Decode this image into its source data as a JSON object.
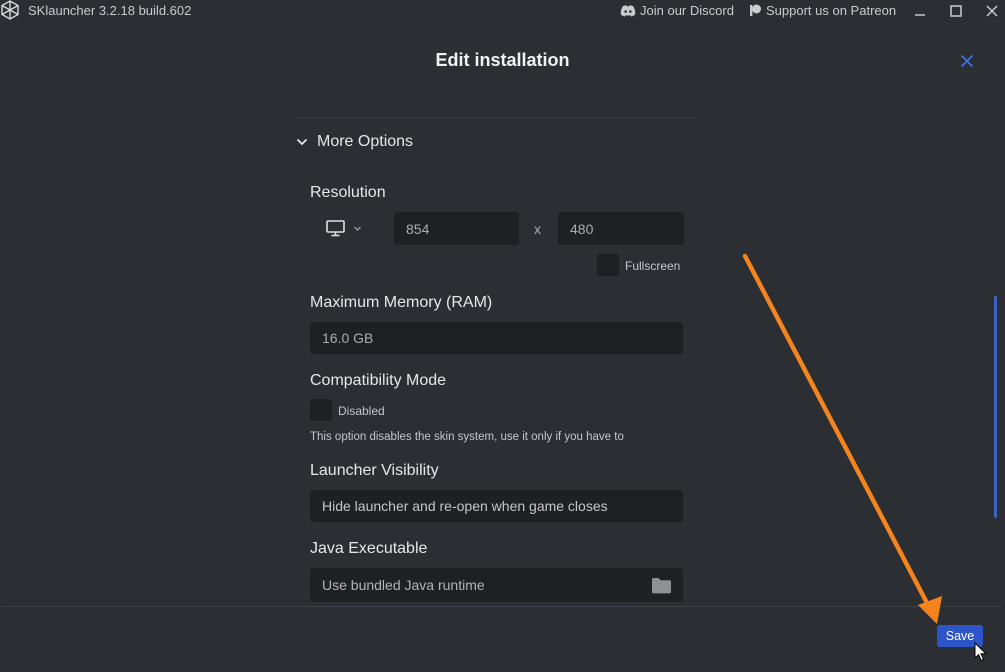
{
  "titlebar": {
    "title": "SKlauncher 3.2.18 build.602",
    "discord_label": "Join our Discord",
    "patreon_label": "Support us on Patreon"
  },
  "dialog": {
    "title": "Edit installation"
  },
  "more_options": {
    "label": "More Options"
  },
  "resolution": {
    "label": "Resolution",
    "width": "854",
    "separator": "x",
    "height": "480",
    "fullscreen_label": "Fullscreen"
  },
  "memory": {
    "label": "Maximum Memory (RAM)",
    "value": "16.0 GB"
  },
  "compatibility": {
    "label": "Compatibility Mode",
    "state_label": "Disabled",
    "hint": "This option disables the skin system, use it only if you have to"
  },
  "visibility": {
    "label": "Launcher Visibility",
    "value": "Hide launcher and re-open when game closes"
  },
  "java": {
    "label": "Java Executable",
    "value": "Use bundled Java runtime"
  },
  "footer": {
    "save_label": "Save"
  },
  "colors": {
    "background": "#2b2e33",
    "field": "#1e2024",
    "accent": "#2c55c9",
    "annotation_arrow": "#f5841f"
  },
  "icons": [
    "app-logo-icon",
    "discord-icon",
    "patreon-icon",
    "minimize-icon",
    "maximize-icon",
    "close-icon",
    "chevron-down-icon",
    "monitor-icon",
    "folder-icon",
    "cursor-icon"
  ]
}
